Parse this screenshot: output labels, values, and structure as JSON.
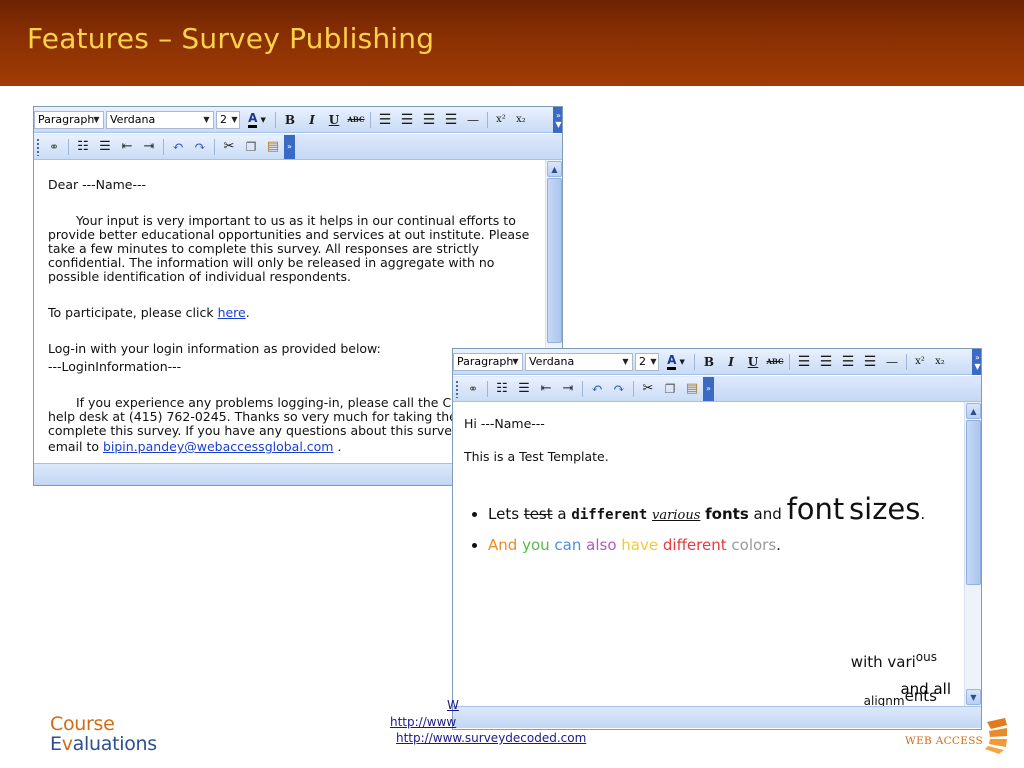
{
  "slide": {
    "title": "Features – Survey Publishing"
  },
  "toolbar": {
    "format": "Paragraph",
    "font": "Verdana",
    "size": "2",
    "bold": "B",
    "italic": "I",
    "underline": "U",
    "strike": "ABC",
    "superscript": "x²",
    "subscript": "x₂"
  },
  "editor1": {
    "greeting": "Dear ---Name---",
    "para1": "Your input is very important to us as it helps in our continual efforts to provide better educational opportunities and services at out institute. Please take a few minutes to complete this survey. All responses are strictly confidential. The information will only be released in aggregate with no possible identification of individual respondents.",
    "participate_prefix": "To participate, please click ",
    "participate_link": "here",
    "participate_suffix": ".",
    "login_line": "Log-in with your login information as provided below:",
    "login_info": "---LoginInformation---",
    "help_line1": "If you experience any problems logging-in, please call the C",
    "help_line2": "help desk at (415) 762-0245. Thanks so very much for taking the t",
    "help_line3": "complete this survey. If you have any questions about this surve",
    "email_prefix": "email to ",
    "email_link": "bipin.pandey@webaccessglobal.com",
    "email_suffix": " ."
  },
  "editor2": {
    "greeting": "Hi ---Name---",
    "intro": "This is a Test Template.",
    "b1_lets": "Lets",
    "b1_test": "test",
    "b1_a": "a",
    "b1_different": "different",
    "b1_various": "various",
    "b1_fonts": "fonts",
    "b1_and": "and",
    "b1_font": "font",
    "b1_sizes": "sizes",
    "b1_dot": ".",
    "b2_and": "And",
    "b2_you": "you",
    "b2_can": "can",
    "b2_also": "also",
    "b2_have": "have",
    "b2_different": "different",
    "b2_colors": "colors",
    "b2_dot": ".",
    "with_vari": "with vari",
    "with_ous": "ous",
    "align_sub": "alignm",
    "align_ents": "ents",
    "and_all": "and all"
  },
  "footer": {
    "link_w": "W",
    "link_http": "http://www",
    "link_survey": "http://www.surveydecoded.com",
    "logo_line1": "Course",
    "logo_e": "E",
    "logo_v": "v",
    "logo_rest": "aluations",
    "webaccess": "WEB ACCESS"
  },
  "colors": {
    "header": "#8a3003",
    "title": "#ffd24a",
    "and": "#f08a24",
    "you": "#58b848",
    "can": "#4b8fe0",
    "also": "#b05ac6",
    "have": "#f2c93b",
    "different": "#e8393b",
    "colors": "#9a9a9a"
  }
}
